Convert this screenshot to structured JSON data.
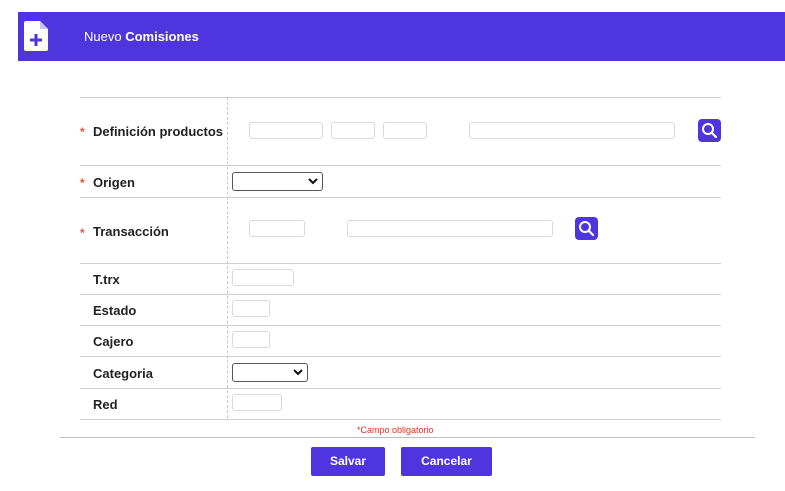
{
  "header": {
    "title_prefix": "Nuevo",
    "title_main": "Comisiones",
    "icon": "document-add-icon",
    "background": "#4f35dd"
  },
  "form": {
    "rows": [
      {
        "label": "Definición productos",
        "required": true
      },
      {
        "label": "Origen",
        "required": true
      },
      {
        "label": "Transacción",
        "required": true
      },
      {
        "label": "T.trx",
        "required": false
      },
      {
        "label": "Estado",
        "required": false
      },
      {
        "label": "Cajero",
        "required": false
      },
      {
        "label": "Categoria",
        "required": false
      },
      {
        "label": "Red",
        "required": false
      }
    ],
    "required_mark": "*"
  },
  "note": {
    "star": "*",
    "text": "Campo obligatorio"
  },
  "buttons": {
    "save": "Salvar",
    "cancel": "Cancelar"
  },
  "colors": {
    "accent": "#4f35dd",
    "required": "#e0301e"
  }
}
